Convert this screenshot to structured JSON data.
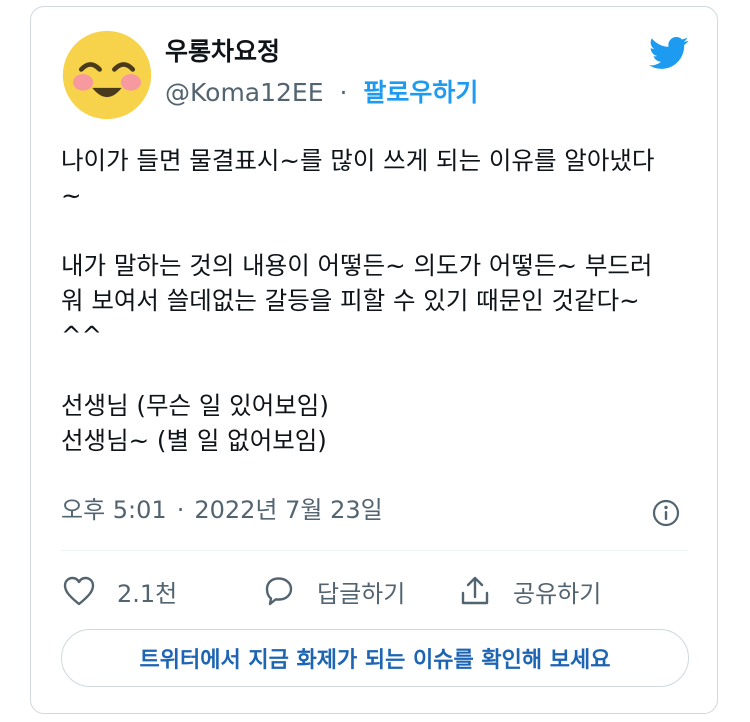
{
  "tweet": {
    "author_name": "우롱차요정",
    "handle": "@Koma12EE",
    "separator": "·",
    "follow_label": "팔로우하기",
    "body": {
      "paragraph1": [
        "나이가 들면 물결표시~를 많이 쓰게 되는 이유를 알아냈다",
        "~"
      ],
      "paragraph2": [
        "내가 말하는 것의 내용이 어떻든~ 의도가 어떻든~ 부드러",
        "워 보여서 쓸데없는 갈등을 피할 수 있기 때문인 것같다~",
        "^^"
      ],
      "paragraph3": [
        "선생님 (무슨 일 있어보임)",
        "선생님~ (별 일 없어보임)"
      ]
    },
    "time": "오후 5:01",
    "date": "2022년 7월 23일",
    "actions": {
      "like_count": "2.1천",
      "reply_label": "답글하기",
      "share_label": "공유하기"
    },
    "trend_button": "트위터에서 지금 화제가 되는 이슈를 확인해 보세요"
  },
  "colors": {
    "accent": "#1d9bf0",
    "secondary_text": "#536471",
    "border": "#cfd9de",
    "trend_text": "#1d65b3"
  },
  "icons": [
    "avatar-smiley",
    "twitter-bird-icon",
    "info-icon",
    "heart-icon",
    "reply-bubble-icon",
    "share-icon"
  ]
}
